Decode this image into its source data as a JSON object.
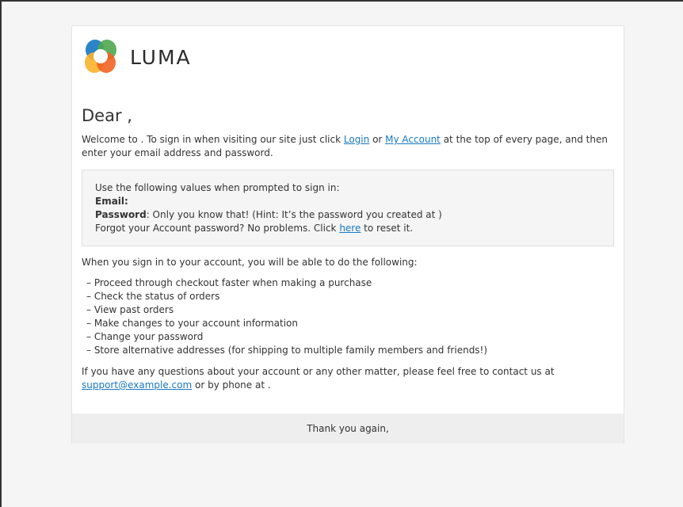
{
  "brand": {
    "name": "LUMA"
  },
  "email": {
    "greeting": "Dear ,",
    "welcome": {
      "before": "Welcome to . To sign in when visiting our site just click ",
      "login_link": "Login",
      "or": " or ",
      "account_link": "My Account",
      "after": " at the top of every page, and then enter your email address and password."
    },
    "credentials": {
      "intro": "Use the following values when prompted to sign in:",
      "email_label": "Email",
      "email_colon": ":",
      "password_label": "Password",
      "password_text": ": Only you know that! (Hint: It’s the password you created at )",
      "forgot_before": "Forgot your Account password? No problems. Click ",
      "forgot_link": "here",
      "forgot_after": " to reset it."
    },
    "features_intro": "When you sign in to your account, you will be able to do the following:",
    "features": [
      "– Proceed through checkout faster when making a purchase",
      "– Check the status of orders",
      "– View past orders",
      "– Make changes to your account information",
      "– Change your password",
      "– Store alternative addresses (for shipping to multiple family members and friends!)"
    ],
    "contact": {
      "before": "If you have any questions about your account or any other matter, please feel free to contact us at ",
      "email_link": "support@example.com",
      "after": " or by phone at ."
    },
    "footer": "Thank you again,"
  },
  "colors": {
    "page_bg": "#f5f5f5",
    "link": "#1979c3",
    "text": "#333333",
    "footer_bg": "#eeeeee",
    "logo_blue": "#1979c3",
    "logo_green": "#4fa74f",
    "logo_yellow": "#f9b22a",
    "logo_orange": "#f26322",
    "logo_red": "#e0403e"
  }
}
